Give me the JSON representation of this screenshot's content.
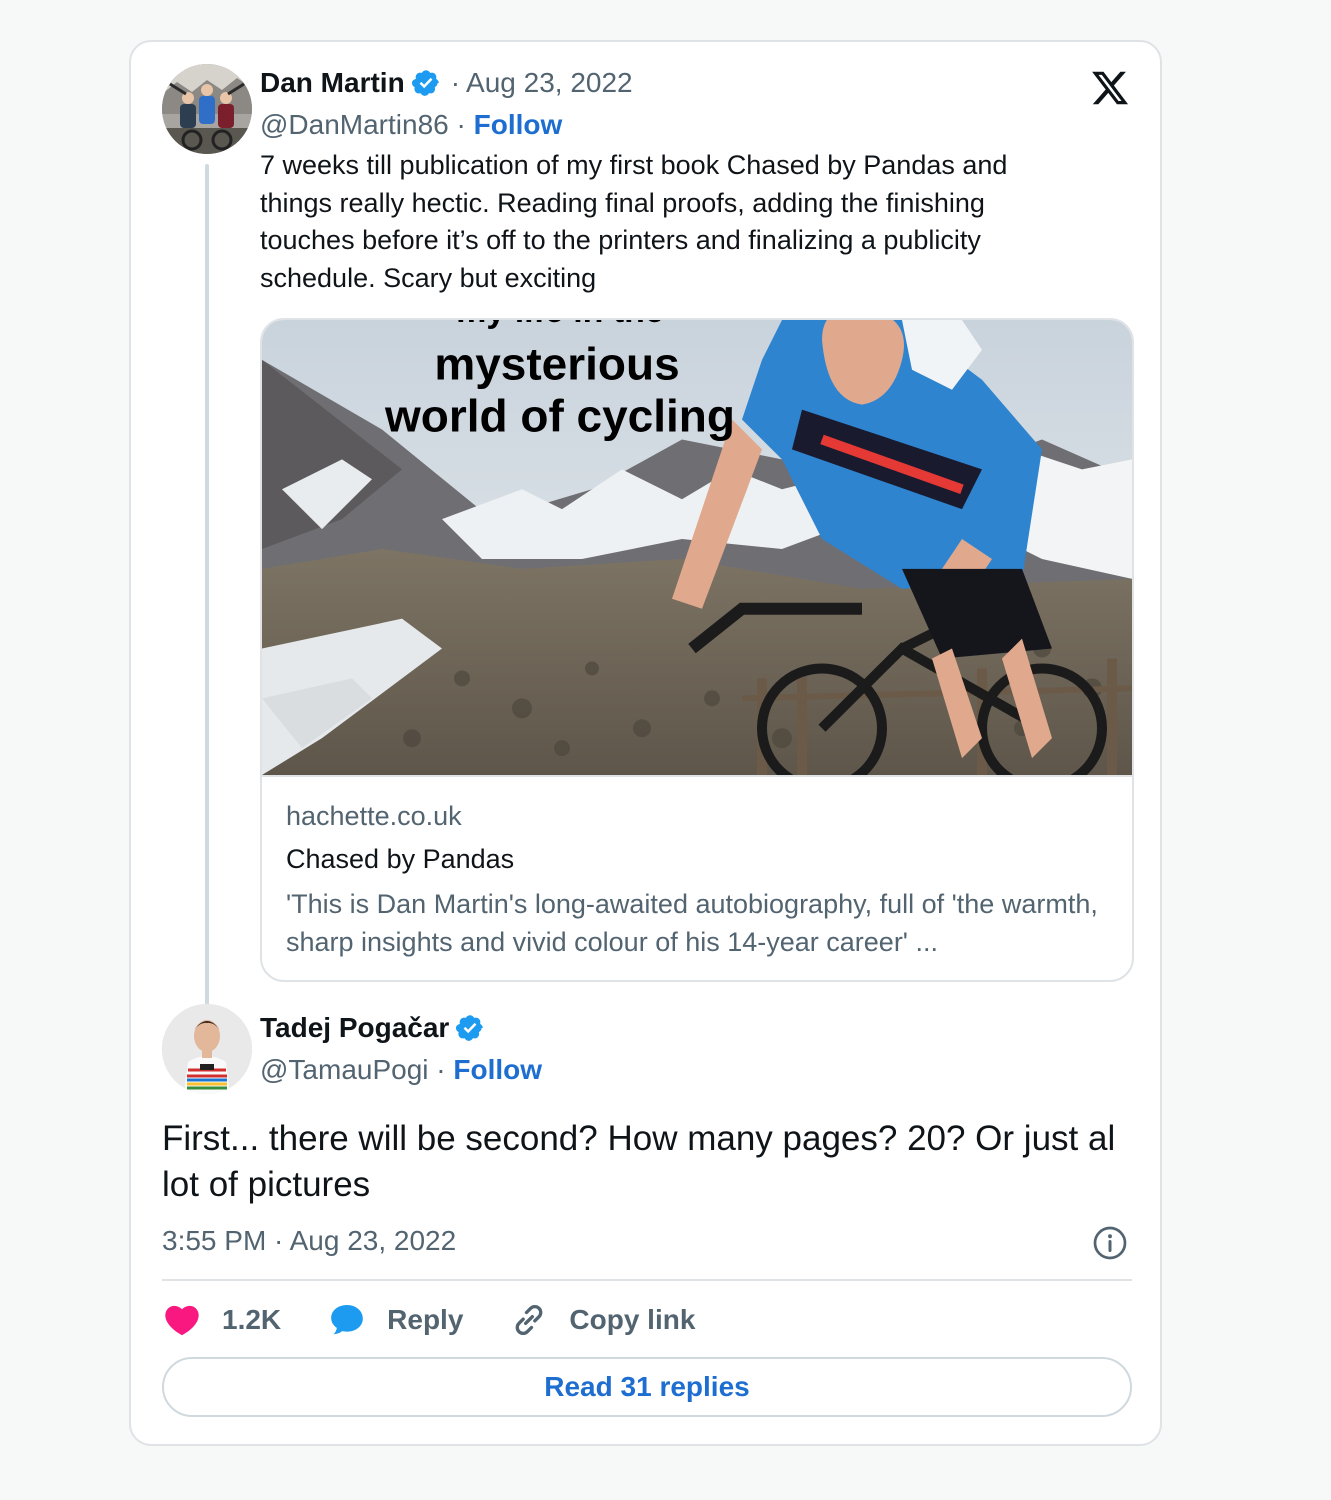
{
  "tweet": {
    "author_name": "Dan Martin",
    "date": "Aug 23, 2022",
    "handle": "@DanMartin86",
    "follow_label": "Follow",
    "text": "7 weeks till publication of my first book Chased by Pandas and things really hectic. Reading final proofs, adding the finishing touches before it’s off to the printers and finalizing a publicity schedule. Scary but exciting",
    "link_card": {
      "image_text_top": "my life in the",
      "image_text_line1": "mysterious",
      "image_text_line2": "world of cycling",
      "domain": "hachette.co.uk",
      "title": "Chased by Pandas",
      "description": "'This is Dan Martin's long-awaited autobiography, full of 'the warmth, sharp insights and vivid colour of his 14-year career' ..."
    }
  },
  "reply": {
    "author_name": "Tadej Pogačar",
    "handle": "@TamauPogi",
    "follow_label": "Follow",
    "text": "First... there will be second? How many pages? 20? Or just al lot of pictures",
    "timestamp": "3:55 PM · Aug 23, 2022",
    "likes": "1.2K",
    "reply_label": "Reply",
    "copy_link_label": "Copy link",
    "read_replies_label": "Read 31 replies"
  },
  "separator": "·",
  "icons": {
    "brand": "x-logo-icon",
    "verified": "verified-badge-icon",
    "info": "info-icon",
    "like": "heart-icon",
    "reply": "speech-bubble-icon",
    "copy": "link-icon"
  },
  "colors": {
    "accent": "#1d6ed0",
    "verified": "#1d9bf0",
    "heart": "#f91880",
    "muted": "#536471",
    "text": "#0f1419"
  }
}
